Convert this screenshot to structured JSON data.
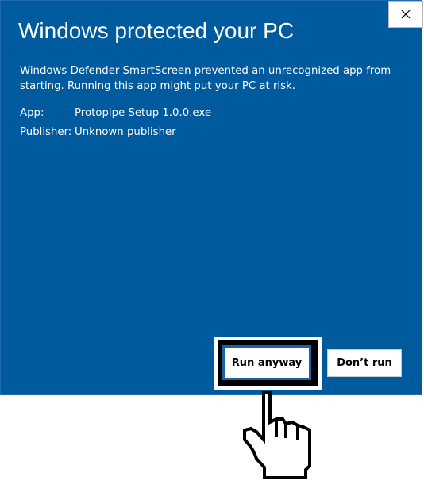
{
  "dialog": {
    "title": "Windows protected your PC",
    "message": "Windows Defender SmartScreen prevented an unrecognized app from starting. Running this app might put your PC at risk.",
    "app_label": "App:",
    "app_value": "Protopipe Setup 1.0.0.exe",
    "publisher_label": "Publisher:",
    "publisher_value": "Unknown publisher",
    "background_color": "#005a9e"
  },
  "buttons": {
    "run_anyway": "Run anyway",
    "dont_run": "Don’t run"
  },
  "icons": {
    "close": "close-icon",
    "cursor": "hand-pointer-cursor-icon"
  },
  "highlight": {
    "target": "run_anyway",
    "colors": [
      "#ffffff",
      "#000000"
    ]
  }
}
